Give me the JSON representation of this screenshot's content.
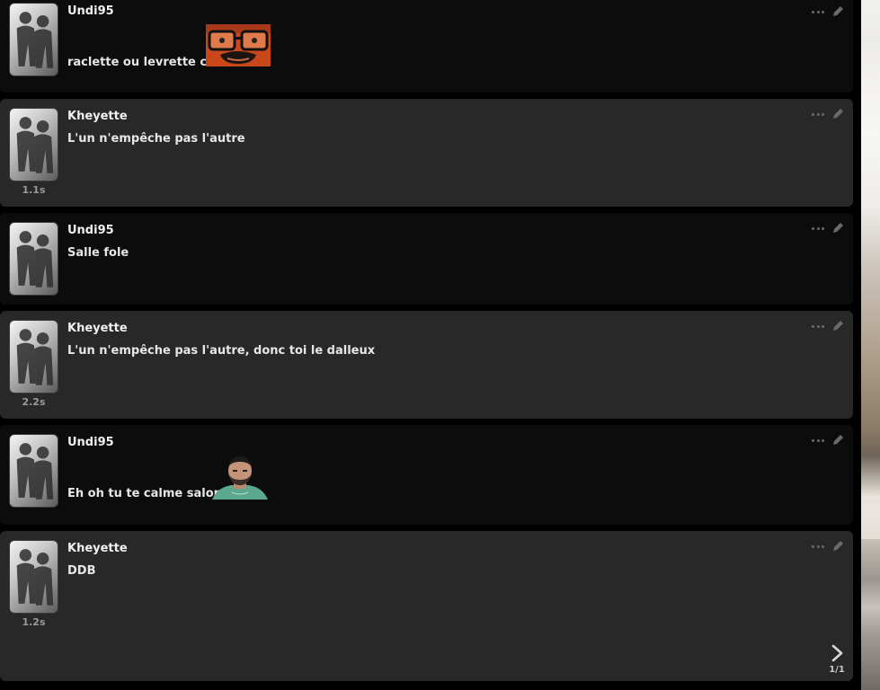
{
  "messages": [
    {
      "user": "Undi95",
      "text": "raclette ou levrette clé ?",
      "timing": "",
      "emote": "glasses-man-emote"
    },
    {
      "user": "Kheyette",
      "text": "L'un n'empêche pas l'autre",
      "timing": "1.1s"
    },
    {
      "user": "Undi95",
      "text": "Salle fole",
      "timing": ""
    },
    {
      "user": "Kheyette",
      "text": "L'un n'empêche pas l'autre, donc toi le dalleux",
      "timing": "2.2s"
    },
    {
      "user": "Undi95",
      "text": "Eh oh tu te calme salope",
      "timing": "",
      "emote": "bearded-man-emote"
    },
    {
      "user": "Kheyette",
      "text": "DDB",
      "timing": "1.2s"
    }
  ],
  "pager": {
    "label": "1/1",
    "icon": "chevron-right-icon"
  },
  "icons": {
    "more": "more-dots-icon",
    "edit": "pencil-icon"
  },
  "colors": {
    "dark_bubble": "#0c0c0c",
    "light_bubble": "#282828",
    "text": "#e6e6e6",
    "timing": "#9a9a9a"
  }
}
